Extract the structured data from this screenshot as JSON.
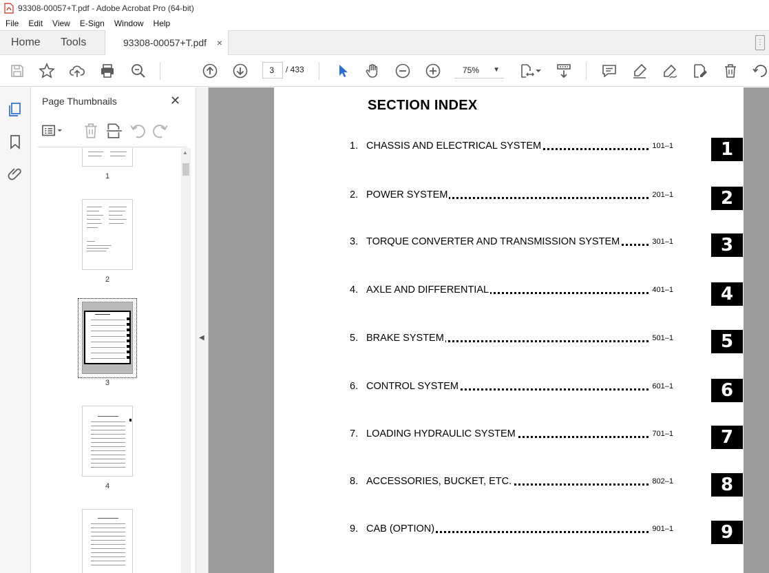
{
  "window": {
    "title": "93308-00057+T.pdf - Adobe Acrobat Pro (64-bit)"
  },
  "menu": [
    "File",
    "Edit",
    "View",
    "E-Sign",
    "Window",
    "Help"
  ],
  "tabs": {
    "home": "Home",
    "tools": "Tools",
    "document": "93308-00057+T.pdf",
    "close": "×"
  },
  "toolbar": {
    "current_page": "3",
    "total_pages": "/  433",
    "zoom": "75%",
    "icons": [
      "save-icon",
      "star-icon",
      "upload-icon",
      "print-icon",
      "zoom-search-icon",
      "prev-page-icon",
      "next-page-icon",
      "select-cursor-icon",
      "hand-icon",
      "zoom-out-icon",
      "zoom-in-icon",
      "fit-page-icon",
      "scroll-mode-icon",
      "comment-icon",
      "highlight-icon",
      "sign-icon",
      "edit-icon",
      "delete-icon",
      "rotate-icon"
    ]
  },
  "panel": {
    "title": "Page Thumbnails",
    "thumb_labels": [
      "1",
      "2",
      "3",
      "4"
    ]
  },
  "document": {
    "title": "SECTION INDEX",
    "entries": [
      {
        "num": "1.",
        "name": "CHASSIS AND ELECTRICAL SYSTEM",
        "page": "101–1",
        "tab": "1"
      },
      {
        "num": "2.",
        "name": "POWER SYSTEM",
        "page": "201–1",
        "tab": "2"
      },
      {
        "num": "3.",
        "name": "TORQUE CONVERTER AND TRANSMISSION SYSTEM",
        "page": "301–1",
        "tab": "3"
      },
      {
        "num": "4.",
        "name": "AXLE AND DIFFERENTIAL",
        "page": "401–1",
        "tab": "4"
      },
      {
        "num": "5.",
        "name": "BRAKE SYSTEM",
        "page": "501–1",
        "tab": "5"
      },
      {
        "num": "6.",
        "name": "CONTROL SYSTEM",
        "page": "601–1",
        "tab": "6"
      },
      {
        "num": "7.",
        "name": "LOADING HYDRAULIC SYSTEM",
        "page": "701–1",
        "tab": "7"
      },
      {
        "num": "8.",
        "name": "ACCESSORIES, BUCKET, ETC.",
        "page": "802–1",
        "tab": "8"
      },
      {
        "num": "9.",
        "name": "CAB (OPTION)",
        "page": "901–1",
        "tab": "9"
      }
    ]
  },
  "colors": {
    "accent": "#2a6fdb",
    "toolbar_icon": "#5a5a5a",
    "doc_background": "#9b9b9b",
    "pdf_red": "#d8281c"
  }
}
